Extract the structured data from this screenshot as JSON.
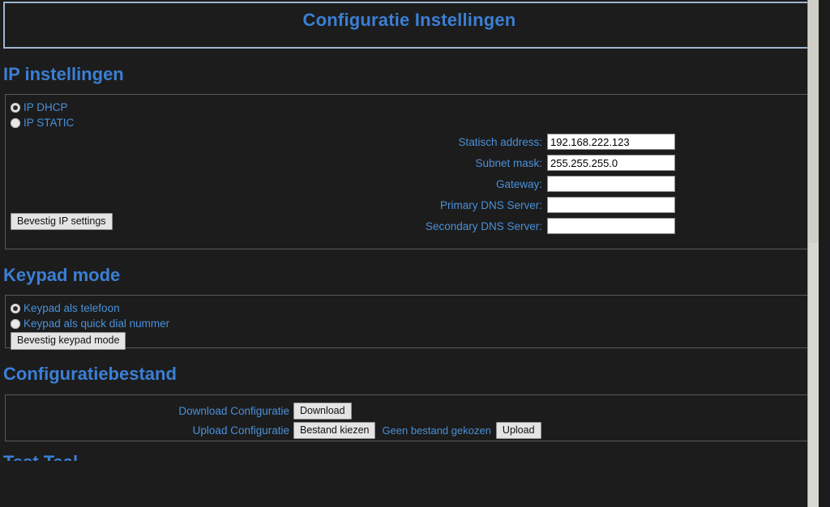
{
  "header": {
    "title": "Configuratie Instellingen"
  },
  "sections": {
    "ip": {
      "heading": "IP instellingen",
      "radios": [
        {
          "label": "IP DHCP",
          "checked": true
        },
        {
          "label": "IP STATIC",
          "checked": false
        }
      ],
      "fields": [
        {
          "label": "Statisch address:",
          "value": "192.168.222.123"
        },
        {
          "label": "Subnet mask:",
          "value": "255.255.255.0"
        },
        {
          "label": "Gateway:",
          "value": ""
        },
        {
          "label": "Primary DNS Server:",
          "value": ""
        },
        {
          "label": "Secondary DNS Server:",
          "value": ""
        }
      ],
      "submit_label": "Bevestig IP settings"
    },
    "keypad": {
      "heading": "Keypad mode",
      "radios": [
        {
          "label": "Keypad als telefoon",
          "checked": true
        },
        {
          "label": "Keypad als quick dial nummer",
          "checked": false
        }
      ],
      "submit_label": "Bevestig keypad mode"
    },
    "config_file": {
      "heading": "Configuratiebestand",
      "download_label": "Download Configuratie",
      "download_button": "Download",
      "upload_label": "Upload Configuratie",
      "choose_button": "Bestand kiezen",
      "no_file_text": "Geen bestand gekozen",
      "upload_button": "Upload"
    },
    "cut_off": {
      "heading": "Test Taal"
    }
  },
  "colors": {
    "background": "#1c1c1c",
    "accent": "#4a90d9",
    "heading": "#3a7fd5",
    "title_border": "#9fb4cc",
    "box_border": "#5a5a52",
    "button_face": "#e4e4e4",
    "input_bg": "#ffffff"
  }
}
